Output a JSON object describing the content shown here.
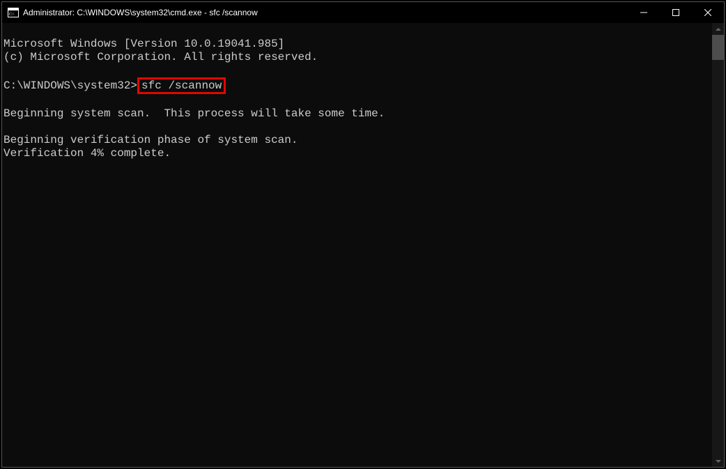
{
  "window": {
    "title": "Administrator: C:\\WINDOWS\\system32\\cmd.exe - sfc  /scannow"
  },
  "console": {
    "line1": "Microsoft Windows [Version 10.0.19041.985]",
    "line2": "(c) Microsoft Corporation. All rights reserved.",
    "blank1": "",
    "prompt_prefix": "C:\\WINDOWS\\system32>",
    "command": "sfc /scannow",
    "blank2": "",
    "line3": "Beginning system scan.  This process will take some time.",
    "blank3": "",
    "line4": "Beginning verification phase of system scan.",
    "line5": "Verification 4% complete."
  }
}
